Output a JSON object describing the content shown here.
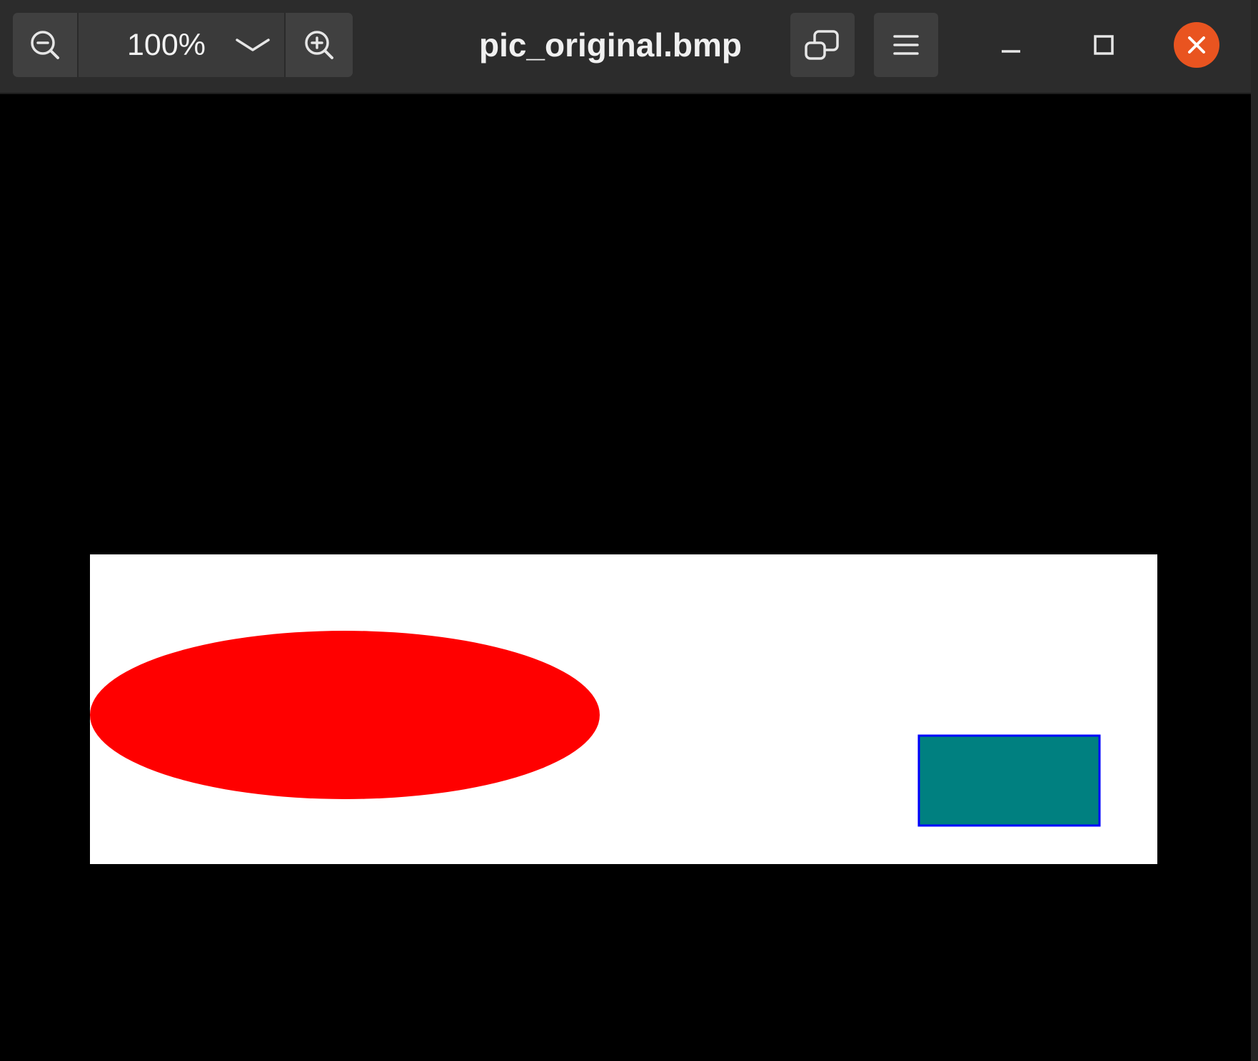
{
  "window": {
    "title": "pic_original.bmp"
  },
  "toolbar": {
    "zoom_out_icon": "zoom-out-icon",
    "zoom_level": "100%",
    "zoom_dropdown_icon": "chevron-down-icon",
    "zoom_in_icon": "zoom-in-icon",
    "restore_icon": "window-restore-icon",
    "menu_icon": "hamburger-menu-icon"
  },
  "window_controls": {
    "minimize_icon": "minimize-icon",
    "maximize_icon": "maximize-icon",
    "close_icon": "close-icon",
    "close_color": "#e95420"
  },
  "image": {
    "background_color": "#ffffff",
    "shapes": [
      {
        "type": "ellipse",
        "fill": "#ff0000"
      },
      {
        "type": "rectangle",
        "fill": "#008080",
        "stroke": "#0000ff"
      }
    ]
  },
  "colors": {
    "titlebar": "#2c2c2c",
    "button": "#3e3e3e",
    "canvas_background": "#000000"
  }
}
